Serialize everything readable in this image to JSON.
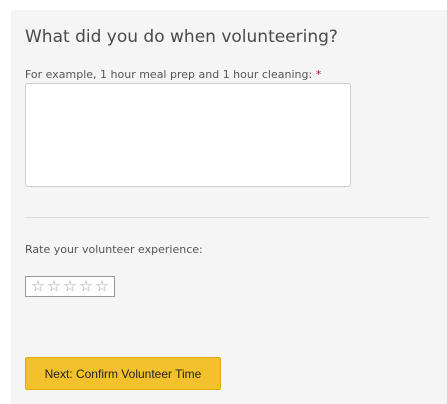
{
  "form": {
    "heading": "What did you do when volunteering?",
    "activity_label": "For example, 1 hour meal prep and 1 hour cleaning:",
    "required_marker": "*",
    "activity_value": "",
    "rating_label": "Rate your volunteer experience:",
    "rating": {
      "max": 5,
      "value": 0,
      "star_glyph": "☆",
      "star_color": "#9a9a9a"
    },
    "next_button_label": "Next: Confirm Volunteer Time",
    "next_button_color": "#f3c12c"
  }
}
